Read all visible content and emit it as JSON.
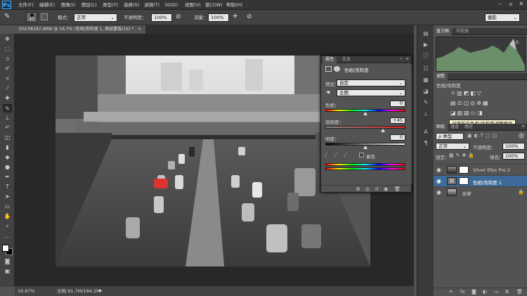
{
  "app": {
    "logo": "Ps"
  },
  "menu": [
    "文件(F)",
    "编辑(E)",
    "图像(I)",
    "图层(L)",
    "类型(Y)",
    "选择(S)",
    "滤镜(T)",
    "3D(D)",
    "视图(V)",
    "窗口(W)",
    "帮助(H)"
  ],
  "window_controls": {
    "minimize": "–",
    "restore": "▫",
    "close": "✕"
  },
  "options": {
    "brush_size": "40",
    "mode_label": "模式：",
    "mode_value": "正常",
    "opacity_label": "不透明度：",
    "opacity_value": "100%",
    "flow_label": "流量：",
    "flow_value": "100%",
    "workspace": "摄影"
  },
  "document": {
    "tab_title": "DSC08187.ARW @ 16.7% (色相/饱和度 1, 图层蒙版/16) *",
    "close": "×"
  },
  "status": {
    "zoom": "16.67%",
    "doc_info": "文档:91.7M/184.2M"
  },
  "properties": {
    "tabs": [
      "属性",
      "信息"
    ],
    "title": "色相/饱和度",
    "preset_label": "预设：",
    "preset_value": "自定",
    "channel_value": "全图",
    "hue_label": "色相：",
    "hue_value": "0",
    "saturation_label": "饱和度：",
    "saturation_value": "+45",
    "lightness_label": "明度：",
    "lightness_value": "0",
    "colorize_label": "着色",
    "hue_level": 0.5,
    "saturation_level": 0.72,
    "lightness_level": 0.5
  },
  "histogram": {
    "tabs": [
      "直方图",
      "导航器"
    ]
  },
  "adjustments": {
    "tab": "调整",
    "subtitle": "色相/饱和度",
    "tooltip": "创建新的色相/饱和度调整图层"
  },
  "layers": {
    "tabs": [
      "图层",
      "通道",
      "路径"
    ],
    "filter_label": "ρ 类型",
    "blend_mode": "正常",
    "opacity_label": "不透明度：",
    "opacity_value": "100%",
    "lock_label": "锁定：",
    "fill_label": "填充：",
    "fill_value": "100%",
    "items": [
      {
        "name": "Silver Efex Pro 2"
      },
      {
        "name": "色相/饱和度 1"
      },
      {
        "name": "背景"
      }
    ]
  },
  "colors": {
    "accent_blue": "#3d6a98",
    "bg_dark": "#282828",
    "panel": "#535353"
  }
}
